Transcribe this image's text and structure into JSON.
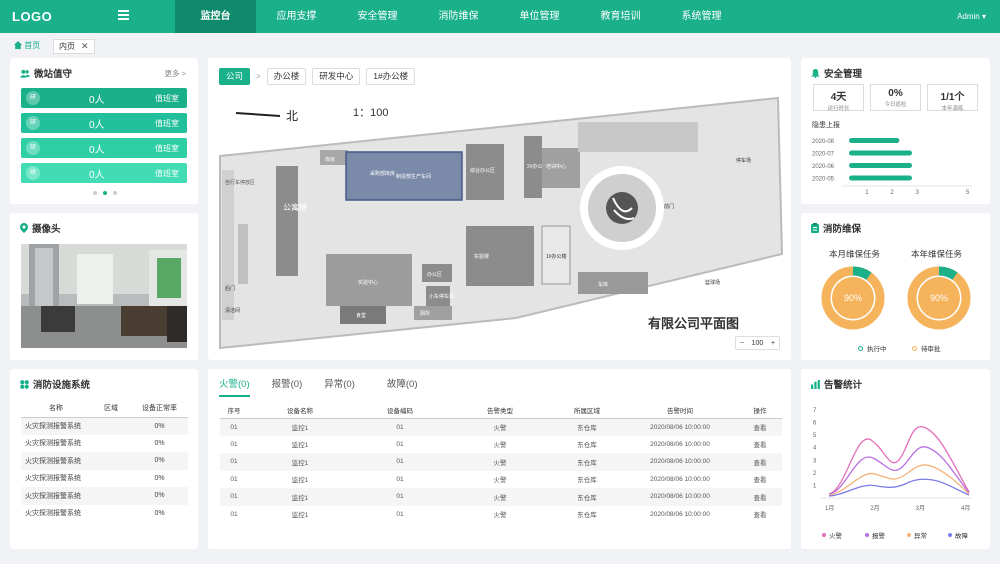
{
  "header": {
    "logo": "LOGO",
    "nav": [
      "监控台",
      "应用支撑",
      "安全管理",
      "消防维保",
      "单位管理",
      "教育培训",
      "系统管理"
    ],
    "user": "Admin ▾"
  },
  "tabs": {
    "home": "首页",
    "inner": "内页",
    "close": "✕"
  },
  "duty": {
    "title": "微站值守",
    "more": "更多 >",
    "rows": [
      {
        "badge": "研",
        "count": "0人",
        "room": "值班室"
      },
      {
        "badge": "研",
        "count": "0人",
        "room": "值班室"
      },
      {
        "badge": "研",
        "count": "0人",
        "room": "值班室"
      },
      {
        "badge": "研",
        "count": "0人",
        "room": "值班室"
      }
    ],
    "colors": [
      "#1ab08a",
      "#22c09a",
      "#2fcfa6",
      "#41dcb4"
    ]
  },
  "camera": {
    "title": "摄像头"
  },
  "map": {
    "crumbs": [
      "公司",
      "办公楼",
      "研发中心",
      "1#办公楼"
    ],
    "sep": ">",
    "north": "北",
    "scale": "1：100",
    "labels": {
      "b1": "公寓楼",
      "b2": "库房",
      "b3": "采购部库房",
      "b4": "制造部生产车间",
      "b5": "综合办公区",
      "b6": "培训中心",
      "b7": "2#办公楼",
      "b8": "实验楼",
      "b9": "1#办公楼",
      "b10": "车库",
      "b11": "办公区",
      "b12": "小车停车场",
      "b13": "实验中心",
      "b14": "食堂",
      "b15": "库房",
      "b16": "厕所",
      "b17": "后门",
      "b18": "清洁间",
      "b19": "自行车停放区",
      "b20": "停车场",
      "b21": "前门",
      "b22": "篮球场",
      "b23": "厕所"
    },
    "footer": "有限公司平面图",
    "zoom": {
      "minus": "−",
      "value": "100",
      "plus": "+"
    }
  },
  "safety": {
    "title": "安全管理",
    "stats": [
      {
        "value": "4天",
        "label": "运行时长"
      },
      {
        "value": "0%",
        "label": "今日巡检"
      },
      {
        "value": "1/1个",
        "label": "本年演练"
      }
    ],
    "chart_title": "隐患上报",
    "chart_data": {
      "type": "bar",
      "orientation": "horizontal",
      "categories": [
        "2020-08",
        "2020-07",
        "2020-06",
        "2020-05"
      ],
      "values": [
        2,
        2.5,
        2.5,
        2.5
      ],
      "xlim": [
        0,
        5
      ],
      "xticks": [
        "1",
        "2",
        "3",
        "5"
      ]
    }
  },
  "maint": {
    "title": "消防维保",
    "monthly": {
      "title": "本月维保任务",
      "value": "90%"
    },
    "yearly": {
      "title": "本年维保任务",
      "value": "90%"
    },
    "legend": [
      "执行中",
      "待审批"
    ],
    "chart_data": [
      {
        "type": "pie",
        "title": "本月维保任务",
        "categories": [
          "执行中",
          "待审批"
        ],
        "values": [
          90,
          10
        ]
      },
      {
        "type": "pie",
        "title": "本年维保任务",
        "categories": [
          "执行中",
          "待审批"
        ],
        "values": [
          90,
          10
        ]
      }
    ]
  },
  "facility": {
    "title": "消防设施系统",
    "headers": [
      "名称",
      "区域",
      "设备正常率"
    ],
    "rows": [
      [
        "火灾探测报警系统",
        "",
        "0%"
      ],
      [
        "火灾探测报警系统",
        "",
        "0%"
      ],
      [
        "火灾探测报警系统",
        "",
        "0%"
      ],
      [
        "火灾探测报警系统",
        "",
        "0%"
      ],
      [
        "火灾探测报警系统",
        "",
        "0%"
      ],
      [
        "火灾探测报警系统",
        "",
        "0%"
      ]
    ]
  },
  "alarms": {
    "tabs": [
      "火警(0)",
      "报警(0)",
      "异常(0)",
      "故障(0)"
    ],
    "headers": [
      "序号",
      "设备名称",
      "设备编码",
      "告警类型",
      "所属区域",
      "告警时间",
      "操作"
    ],
    "rows": [
      [
        "01",
        "监控1",
        "01",
        "火警",
        "东仓库",
        "2020/08/06 10:00:00",
        "查看"
      ],
      [
        "01",
        "监控1",
        "01",
        "火警",
        "东仓库",
        "2020/08/06 10:00:00",
        "查看"
      ],
      [
        "01",
        "监控1",
        "01",
        "火警",
        "东仓库",
        "2020/08/06 10:00:00",
        "查看"
      ],
      [
        "01",
        "监控1",
        "01",
        "火警",
        "东仓库",
        "2020/08/06 10:00:00",
        "查看"
      ],
      [
        "01",
        "监控1",
        "01",
        "火警",
        "东仓库",
        "2020/08/06 10:00:00",
        "查看"
      ],
      [
        "01",
        "监控1",
        "01",
        "火警",
        "东仓库",
        "2020/08/06 10:00:00",
        "查看"
      ]
    ]
  },
  "stats": {
    "title": "告警统计",
    "chart_data": {
      "type": "line",
      "x": [
        "1月",
        "2月",
        "3月",
        "4月"
      ],
      "yticks": [
        "1",
        "2",
        "3",
        "4",
        "5",
        "6",
        "7"
      ],
      "ylim": [
        0,
        7
      ],
      "series": [
        {
          "name": "火警",
          "color": "#e36fb9"
        },
        {
          "name": "报警",
          "color": "#b86fe0"
        },
        {
          "name": "异常",
          "color": "#f5b37a"
        },
        {
          "name": "故障",
          "color": "#7b7be8"
        }
      ]
    }
  }
}
